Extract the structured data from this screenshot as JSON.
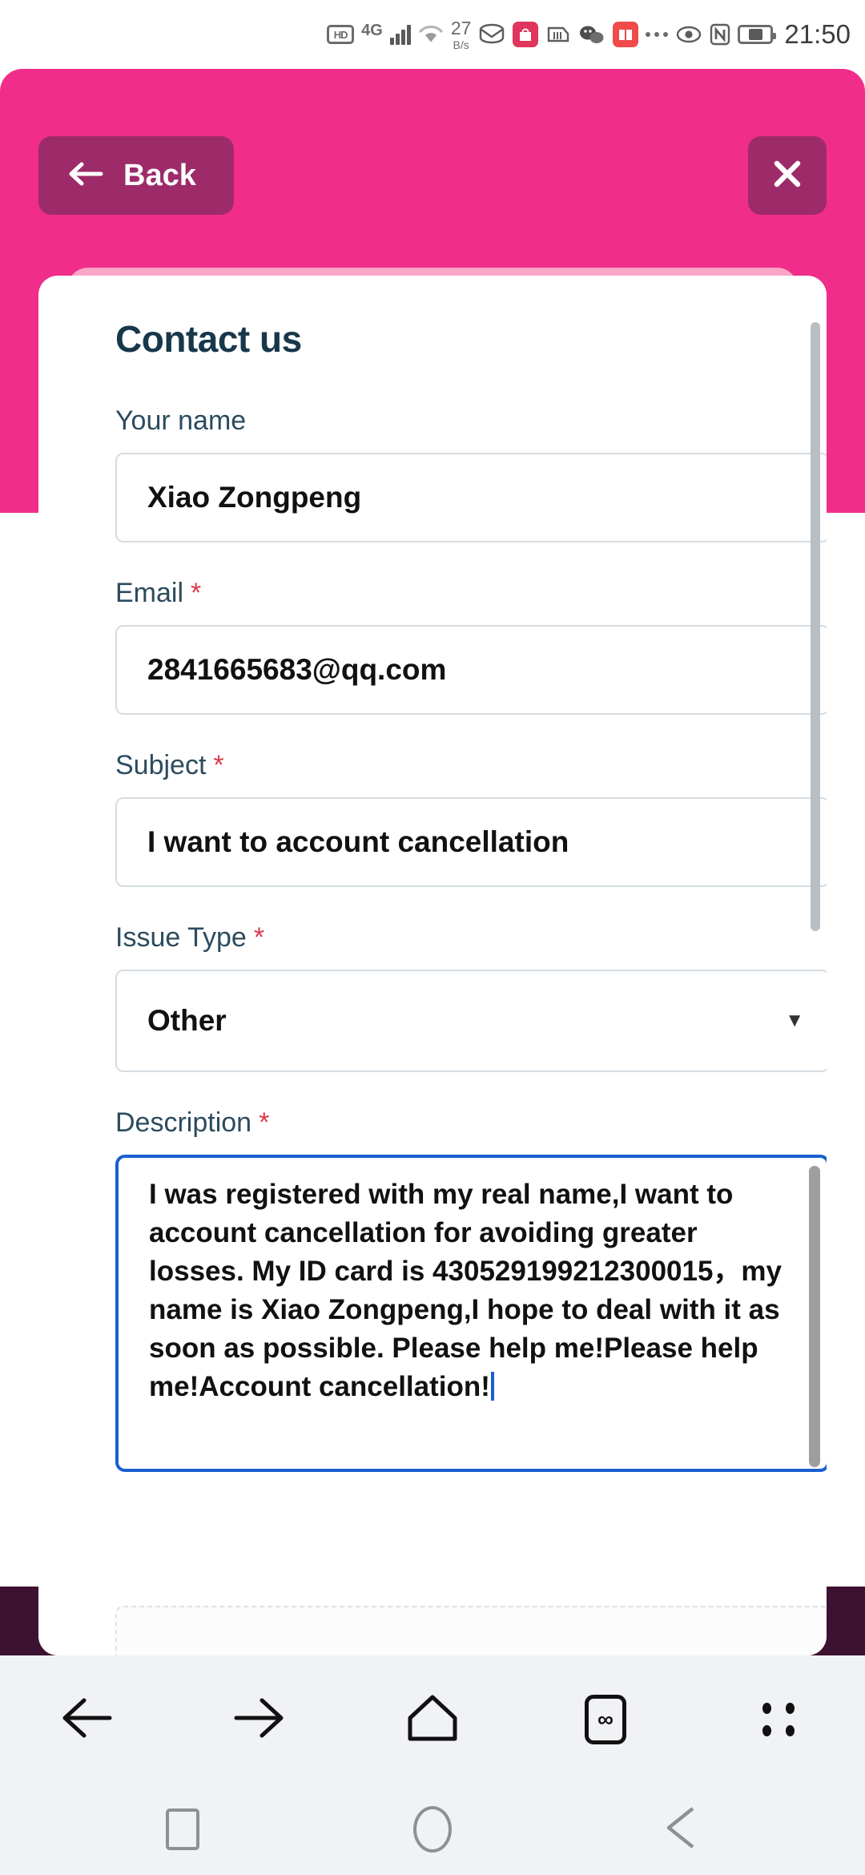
{
  "statusbar": {
    "hd_label": "HD",
    "network_label": "4G",
    "net_speed_value": "27",
    "net_speed_unit": "B/s",
    "icons": [
      "hd-icon",
      "signal-4g-icon",
      "signal-bars-icon",
      "wifi-icon",
      "net-speed-icon",
      "mail-icon",
      "shop-icon",
      "bank-icon",
      "wechat-icon",
      "xiaohongshu-icon",
      "more-icons",
      "eye-icon",
      "nfc-icon",
      "battery-icon"
    ],
    "time": "21:50"
  },
  "header": {
    "back_label": "Back",
    "back_icon": "arrow-left-icon",
    "close_icon": "close-icon",
    "accent_color": "#f02d8a",
    "button_color": "#9d2b6a"
  },
  "form": {
    "title": "Contact us",
    "required_mark": "*",
    "fields": [
      {
        "label": "Your name",
        "required": false,
        "value": "Xiao Zongpeng",
        "placeholder": ""
      },
      {
        "label": "Email",
        "required": true,
        "value": "2841665683@qq.com",
        "placeholder": ""
      },
      {
        "label": "Subject",
        "required": true,
        "value": "I want to account cancellation",
        "placeholder": ""
      },
      {
        "label": "Issue Type",
        "required": true,
        "value": "Other",
        "placeholder": ""
      },
      {
        "label": "Description",
        "required": true,
        "value": "I was registered with my real name,I want to account cancellation for avoiding greater losses. My ID card is 430529199212300015，my name is Xiao Zongpeng,I hope to deal with it as soon as possible. Please help me!Please help me!Account cancellation!",
        "placeholder": ""
      }
    ],
    "select_caret": "▼",
    "focus_color": "#1a5fd0"
  },
  "browser_nav": {
    "items": [
      {
        "name": "back",
        "icon": "arrow-left-icon"
      },
      {
        "name": "forward",
        "icon": "arrow-right-icon"
      },
      {
        "name": "home",
        "icon": "home-icon"
      },
      {
        "name": "tabs",
        "icon": "tabs-infinity-icon",
        "badge": "∞"
      },
      {
        "name": "menu",
        "icon": "menu-dots-icon"
      }
    ]
  },
  "system_nav": {
    "items": [
      {
        "name": "recents",
        "icon": "square-icon"
      },
      {
        "name": "home",
        "icon": "circle-icon"
      },
      {
        "name": "back",
        "icon": "triangle-back-icon"
      }
    ]
  }
}
